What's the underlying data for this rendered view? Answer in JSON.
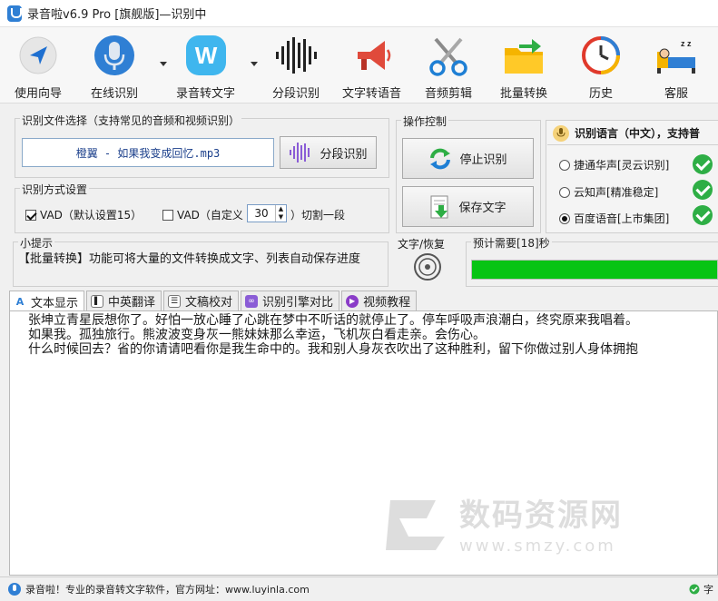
{
  "window": {
    "title": "录音啦v6.9 Pro [旗舰版]—识别中"
  },
  "toolbar": {
    "items": [
      {
        "label": "使用向导",
        "icon": "navigation-arrow-icon"
      },
      {
        "label": "在线识别",
        "icon": "microphone-icon"
      },
      {
        "label": "录音转文字",
        "icon": "w-logo-icon"
      },
      {
        "label": "分段识别",
        "icon": "soundwave-icon"
      },
      {
        "label": "文字转语音",
        "icon": "megaphone-icon"
      },
      {
        "label": "音频剪辑",
        "icon": "scissors-icon"
      },
      {
        "label": "批量转换",
        "icon": "folder-arrow-icon"
      },
      {
        "label": "历史",
        "icon": "history-clock-icon"
      },
      {
        "label": "客服",
        "icon": "sleeping-bed-icon"
      }
    ]
  },
  "file_select": {
    "group_title": "识别文件选择（支持常见的音频和视频识别）",
    "file_name": "橙翼 - 如果我变成回忆.mp3",
    "segment_button": "分段识别"
  },
  "mode": {
    "group_title": "识别方式设置",
    "vad_default_label": "VAD（默认设置15）",
    "vad_default_checked": true,
    "vad_custom_label": "VAD（自定义",
    "vad_custom_checked": false,
    "vad_custom_value": "30",
    "cut_label": "）切割一段"
  },
  "control": {
    "group_title": "操作控制",
    "stop_button": "停止识别",
    "save_button": "保存文字"
  },
  "language": {
    "header": "识别语言（中文），支持普",
    "options": [
      {
        "label": "捷通华声[灵云识别]",
        "selected": false
      },
      {
        "label": "云知声[精准稳定]",
        "selected": false
      },
      {
        "label": "百度语音[上市集团]",
        "selected": true
      }
    ]
  },
  "tips": {
    "title": "小提示",
    "text": "【批量转换】功能可将大量的文件转换成文字、列表自动保存进度"
  },
  "recover": {
    "title": "文字/恢复"
  },
  "progress": {
    "title": "预计需要[18]秒",
    "fraction": 1.0,
    "color": "#07c414"
  },
  "tabs": [
    {
      "label": "文本显示",
      "icon": "text-a-icon",
      "active": true
    },
    {
      "label": "中英翻译",
      "icon": "translate-icon",
      "active": false
    },
    {
      "label": "文稿校对",
      "icon": "proofread-icon",
      "active": false
    },
    {
      "label": "识别引擎对比",
      "icon": "compare-icon",
      "active": false
    },
    {
      "label": "视频教程",
      "icon": "video-play-icon",
      "active": false
    }
  ],
  "transcript": {
    "lines": [
      "张坤立青星辰想你了。好怕一放心睡了心跳在梦中不听话的就停止了。停车呼吸声浪潮白，终究原来我唱着。",
      "如果我。孤独旅行。熊波波变身灰一熊妹妹那么幸运，飞机灰白看走亲。会伤心。",
      "什么时候回去？省的你请请吧看你是我生命中的。我和别人身灰衣吹出了这种胜利，留下你做过别人身体拥抱"
    ]
  },
  "watermark": {
    "text": "数码资源网",
    "url": "www.smzy.com"
  },
  "status": {
    "text": "录音啦！专业的录音转文字软件，官方网址：www.luyinla.com",
    "right_text": "字"
  },
  "colors": {
    "accent_blue": "#2f7fd4",
    "ok_green": "#2eae45",
    "progress_green": "#07c414"
  }
}
